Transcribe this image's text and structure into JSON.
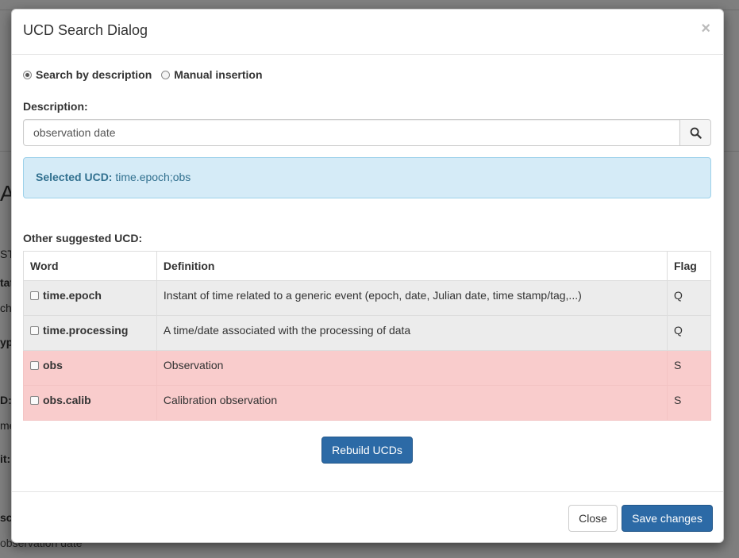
{
  "background": {
    "big_letter": "A",
    "fragments": [
      "ST",
      "tat",
      "cha",
      "ype",
      "D:",
      "me",
      "it:",
      "sc"
    ],
    "bottom_text": "observation date"
  },
  "dialog": {
    "title": "UCD Search Dialog",
    "close_symbol": "×",
    "mode_options": [
      {
        "label": "Search by description",
        "checked": true
      },
      {
        "label": "Manual insertion",
        "checked": false
      }
    ],
    "description_label": "Description:",
    "search": {
      "value": "observation date",
      "icon": "search-icon"
    },
    "selected": {
      "label": "Selected UCD:",
      "value": "time.epoch;obs"
    },
    "other_label": "Other suggested UCD:",
    "table": {
      "headers": {
        "word": "Word",
        "definition": "Definition",
        "flag": "Flag"
      },
      "rows": [
        {
          "word": "time.epoch",
          "definition": "Instant of time related to a generic event (epoch, date, Julian date, time stamp/tag,...)",
          "flag": "Q"
        },
        {
          "word": "time.processing",
          "definition": "A time/date associated with the processing of data",
          "flag": "Q"
        },
        {
          "word": "obs",
          "definition": "Observation",
          "flag": "S"
        },
        {
          "word": "obs.calib",
          "definition": "Calibration observation",
          "flag": "S"
        }
      ]
    },
    "rebuild_label": "Rebuild UCDs",
    "footer": {
      "close_label": "Close",
      "save_label": "Save changes"
    }
  },
  "colors": {
    "primary": "#2c6aa6",
    "info_bg": "#d5ebf7",
    "row_q": "#ececec",
    "row_s": "#f9cccc"
  }
}
